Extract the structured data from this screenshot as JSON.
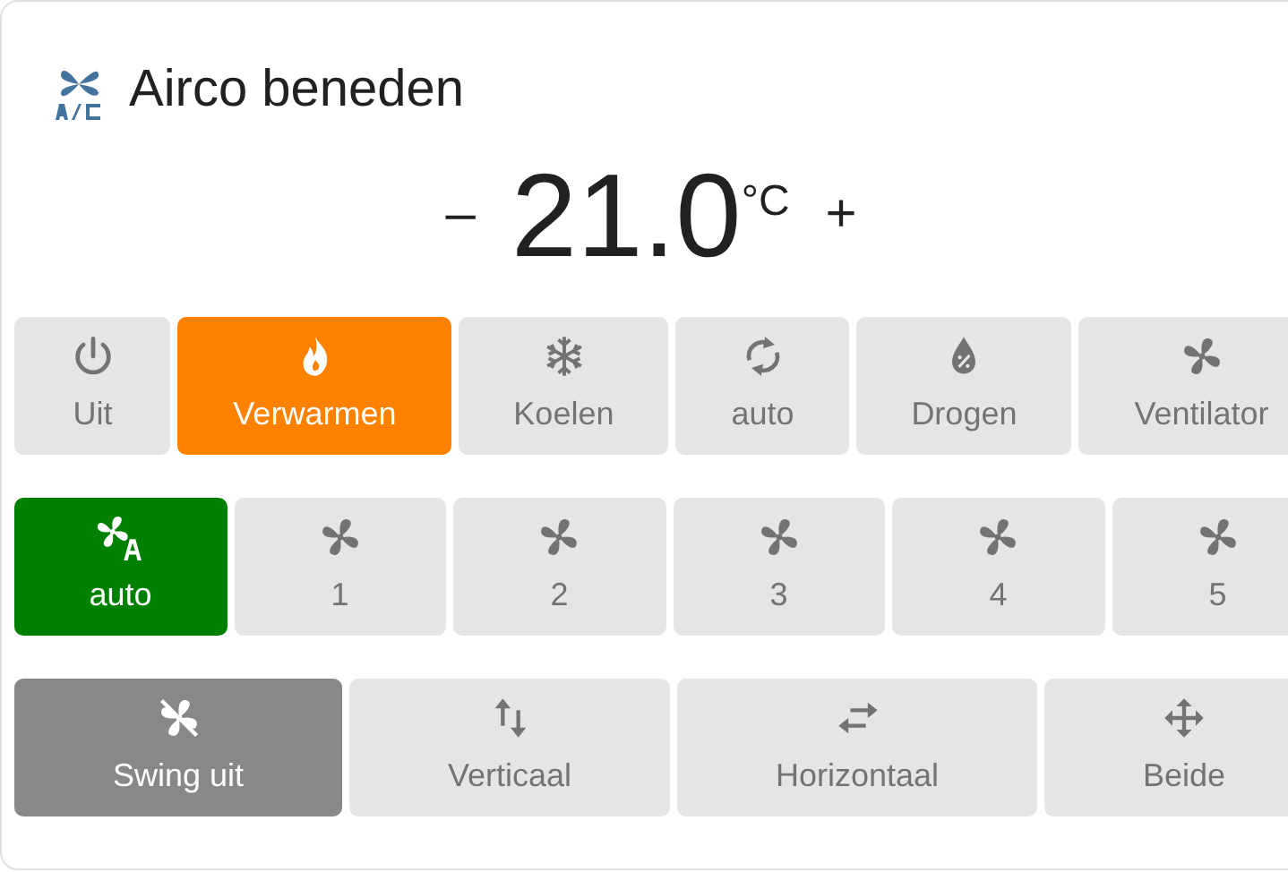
{
  "title": "Airco beneden",
  "temperature": {
    "decrease": "–",
    "value": "21.0",
    "unit": "°C",
    "increase": "+"
  },
  "groups": [
    {
      "kind": "mode",
      "buttons": [
        {
          "label": "Uit",
          "kind": "power",
          "selected": false
        },
        {
          "label": "Verwarmen",
          "kind": "fire",
          "selected": true
        },
        {
          "label": "Koelen",
          "kind": "snowflake",
          "selected": false
        },
        {
          "label": "auto",
          "kind": "sync",
          "selected": false
        },
        {
          "label": "Drogen",
          "kind": "drop",
          "selected": false
        },
        {
          "label": "Ventilator",
          "kind": "fan",
          "selected": false
        }
      ]
    },
    {
      "kind": "fan",
      "buttons": [
        {
          "label": "auto",
          "kind": "fan-auto",
          "selected": true
        },
        {
          "label": "1",
          "kind": "fan",
          "selected": false
        },
        {
          "label": "2",
          "kind": "fan",
          "selected": false
        },
        {
          "label": "3",
          "kind": "fan",
          "selected": false
        },
        {
          "label": "4",
          "kind": "fan",
          "selected": false
        },
        {
          "label": "5",
          "kind": "fan",
          "selected": false
        }
      ]
    },
    {
      "kind": "swing",
      "buttons": [
        {
          "label": "Swing uit",
          "kind": "fan-off",
          "selected": true
        },
        {
          "label": "Verticaal",
          "kind": "arrows-vertical",
          "selected": false
        },
        {
          "label": "Horizontaal",
          "kind": "arrows-horizontal",
          "selected": false
        },
        {
          "label": "Beide",
          "kind": "arrows-all",
          "selected": false
        }
      ]
    }
  ]
}
